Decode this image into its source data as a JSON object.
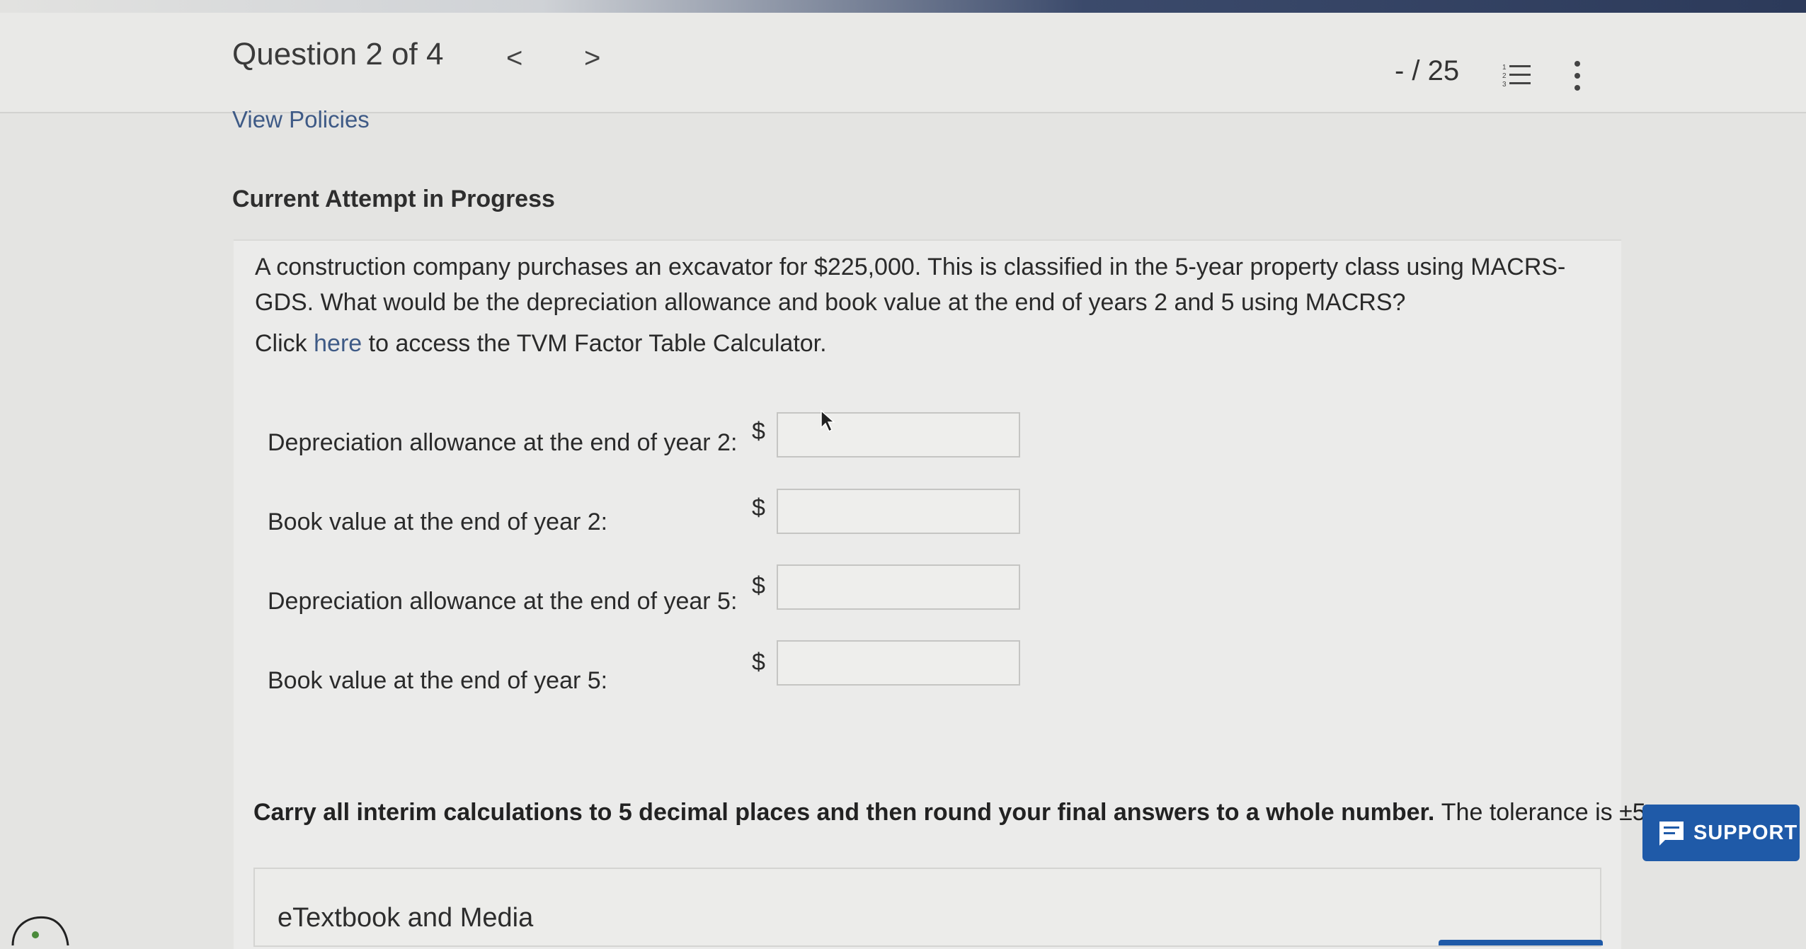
{
  "header": {
    "question_title": "Question 2 of 4",
    "prev_glyph": "<",
    "next_glyph": ">",
    "score": "- / 25",
    "list_icon": "numbered-list-icon",
    "more_icon": "more-vertical-icon"
  },
  "links": {
    "view_policies": "View Policies"
  },
  "attempt_status": "Current Attempt in Progress",
  "question": {
    "text": "A construction company purchases an excavator for $225,000. This is classified in the 5-year property class using MACRS-GDS. What would be the depreciation allowance and book value at the end of years 2 and 5 using MACRS?",
    "click_prefix": "Click",
    "click_link": "here",
    "click_suffix": "to access the TVM Factor Table Calculator."
  },
  "answers": [
    {
      "label": "Depreciation allowance at the end of year 2:",
      "currency": "$",
      "value": ""
    },
    {
      "label": "Book value at the end of year 2:",
      "currency": "$",
      "value": ""
    },
    {
      "label": "Depreciation allowance at the end of year 5:",
      "currency": "$",
      "value": ""
    },
    {
      "label": "Book value at the end of year 5:",
      "currency": "$",
      "value": ""
    }
  ],
  "note": {
    "bold": "Carry all interim calculations to 5 decimal places and then round your final answers to a whole number.",
    "plain": "The tolerance is ±5."
  },
  "etextbook": "eTextbook and Media",
  "support_button": "SUPPORT",
  "colors": {
    "link": "#3e5a86",
    "support_bg": "#1f5aa8",
    "background": "#e4e4e2"
  }
}
